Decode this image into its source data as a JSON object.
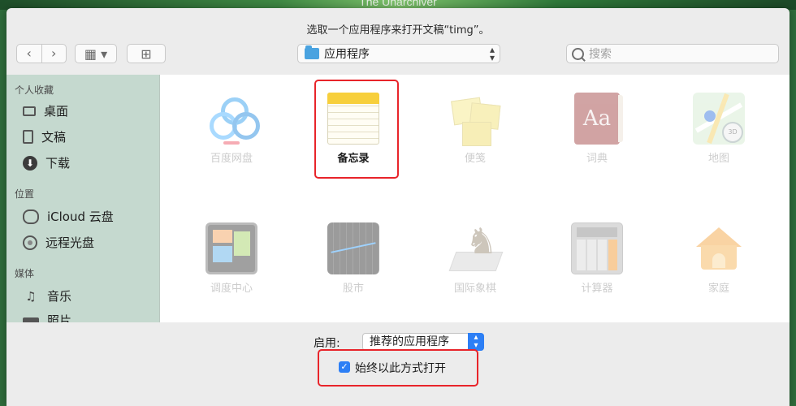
{
  "background_title": "The Unarchiver",
  "dialog": {
    "prompt": "选取一个应用程序来打开文稿“timg”。"
  },
  "toolbar": {
    "back_glyph": "‹",
    "forward_glyph": "›",
    "view_glyph": "▦ ▾",
    "newfolder_glyph": "⊞",
    "location": "应用程序",
    "search_placeholder": "搜索"
  },
  "sidebar": {
    "sections": [
      {
        "title": "个人收藏",
        "items": [
          {
            "label": "桌面",
            "icon": "desktop-icon"
          },
          {
            "label": "文稿",
            "icon": "documents-icon"
          },
          {
            "label": "下载",
            "icon": "download-icon"
          }
        ]
      },
      {
        "title": "位置",
        "items": [
          {
            "label": "iCloud 云盘",
            "icon": "icloud-icon"
          },
          {
            "label": "远程光盘",
            "icon": "disc-icon"
          }
        ]
      },
      {
        "title": "媒体",
        "items": [
          {
            "label": "音乐",
            "icon": "music-icon"
          },
          {
            "label": "照片",
            "icon": "photos-icon"
          }
        ]
      }
    ]
  },
  "apps": [
    {
      "name": "百度网盘",
      "icon": "baidu-netdisk-icon",
      "enabled": false
    },
    {
      "name": "备忘录",
      "icon": "notes-icon",
      "enabled": true,
      "selected": true
    },
    {
      "name": "便笺",
      "icon": "stickies-icon",
      "enabled": false
    },
    {
      "name": "词典",
      "icon": "dictionary-icon",
      "enabled": false
    },
    {
      "name": "地图",
      "icon": "maps-icon",
      "enabled": false
    },
    {
      "name": "调度中心",
      "icon": "mission-control-icon",
      "enabled": false
    },
    {
      "name": "股市",
      "icon": "stocks-icon",
      "enabled": false
    },
    {
      "name": "国际象棋",
      "icon": "chess-icon",
      "enabled": false
    },
    {
      "name": "计算器",
      "icon": "calculator-icon",
      "enabled": false
    },
    {
      "name": "家庭",
      "icon": "home-icon",
      "enabled": false
    }
  ],
  "icon_text": {
    "dictionary": "Aa",
    "maps_compass": "3D"
  },
  "bottom": {
    "enable_label": "启用:",
    "enable_value": "推荐的应用程序",
    "always_open_label": "始终以此方式打开",
    "always_open_checked": true
  },
  "colors": {
    "highlight": "#e8242a",
    "accent": "#2d7ff5",
    "sidebar_bg": "#c5d9cf"
  }
}
